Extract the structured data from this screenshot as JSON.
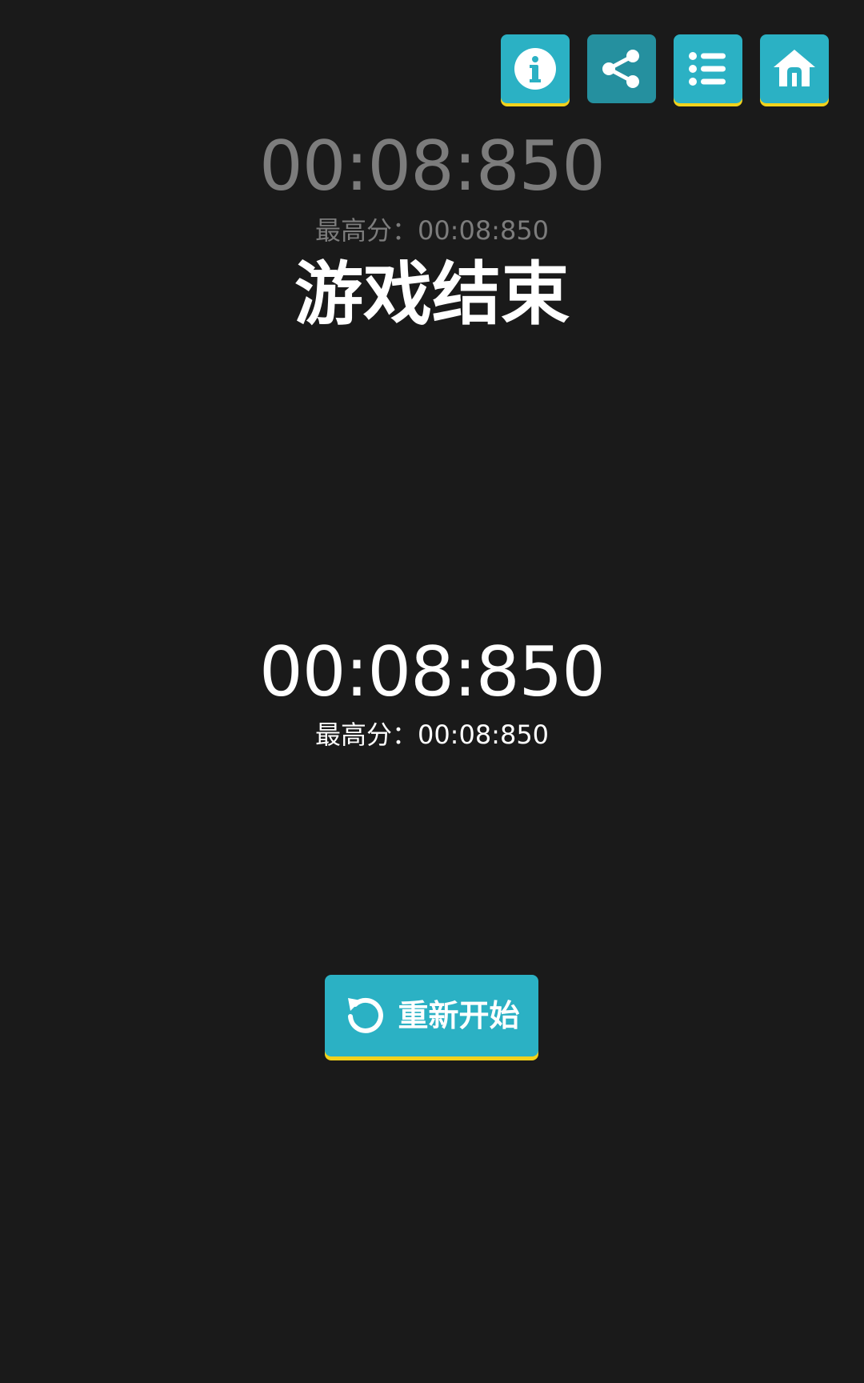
{
  "toolbar": {
    "buttons": [
      {
        "icon": "info-icon"
      },
      {
        "icon": "share-icon"
      },
      {
        "icon": "list-icon"
      },
      {
        "icon": "home-icon"
      }
    ]
  },
  "top_section": {
    "time": "00:08:850",
    "best_score": "最高分：00:08:850"
  },
  "status": {
    "title": "游戏结束"
  },
  "main_section": {
    "time": "00:08:850",
    "best_score": "最高分：00:08:850"
  },
  "restart": {
    "label": "重新开始",
    "icon": "restart-icon"
  },
  "colors": {
    "background": "#1a1a1a",
    "button": "#2bb1c4",
    "button_dim": "#25909f",
    "button_shadow": "#f2d21b",
    "muted_text": "#7c7c7c",
    "text": "#ffffff"
  }
}
